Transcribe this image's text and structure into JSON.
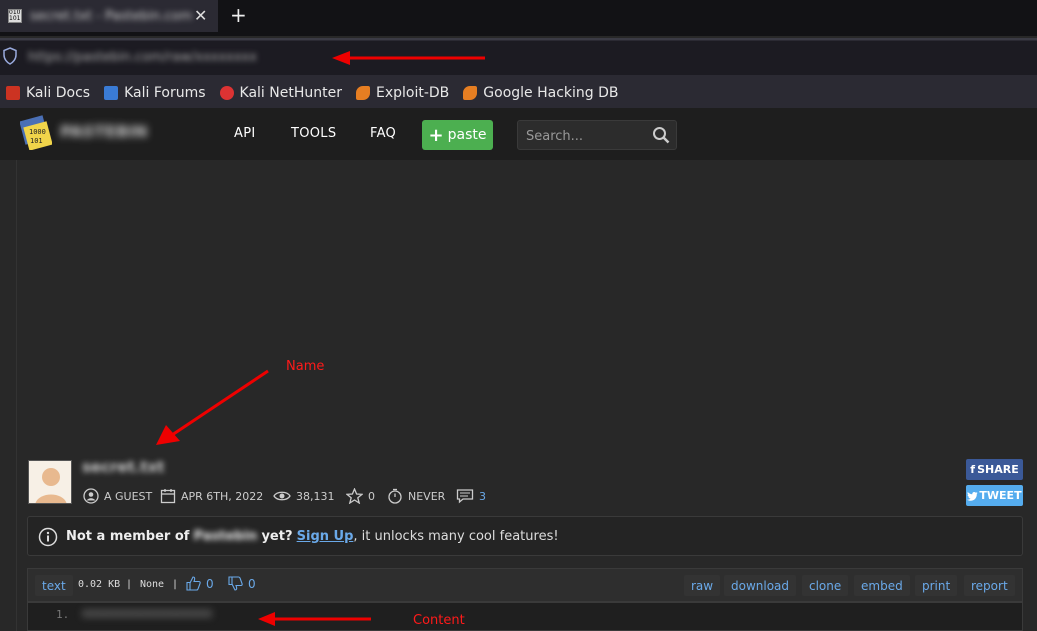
{
  "browser": {
    "tab_title": "secret.txt - Pastebin.com",
    "url": "https://pastebin.com/raw/xxxxxxxx",
    "bookmarks": [
      {
        "label": "Kali Docs",
        "icon": "kali-docs-icon"
      },
      {
        "label": "Kali Forums",
        "icon": "kali-forums-icon"
      },
      {
        "label": "Kali NetHunter",
        "icon": "kali-nethunter-icon"
      },
      {
        "label": "Exploit-DB",
        "icon": "exploit-db-icon"
      },
      {
        "label": "Google Hacking DB",
        "icon": "ghdb-icon"
      }
    ]
  },
  "site": {
    "name": "PASTEBIN",
    "nav": {
      "api": "API",
      "tools": "TOOLS",
      "faq": "FAQ"
    },
    "paste_button": "paste",
    "search_placeholder": "Search..."
  },
  "annotations": {
    "name": "Name",
    "content": "Content"
  },
  "paste": {
    "title": "secret.txt",
    "author": "A GUEST",
    "date": "APR 6TH, 2022",
    "views": "38,131",
    "stars": "0",
    "expires": "NEVER",
    "comments": "3",
    "share_label": "SHARE",
    "tweet_label": "TWEET"
  },
  "notice": {
    "prefix": "Not a member of",
    "site": "Pastebin",
    "suffix": "yet?",
    "signup": "Sign Up",
    "rest": ", it unlocks many cool features!"
  },
  "toolbar": {
    "syntax": "text",
    "size": "0.02 KB",
    "category": "None",
    "likes": "0",
    "dislikes": "0",
    "actions": [
      "raw",
      "download",
      "clone",
      "embed",
      "print",
      "report"
    ]
  },
  "code": {
    "line_number": "1.",
    "line": "xxxxxxxxxxxxxxxxxx"
  },
  "colors": {
    "accent_green": "#4caf50",
    "link_blue": "#6aa9e9",
    "annotation_red": "#ff1a1a"
  }
}
